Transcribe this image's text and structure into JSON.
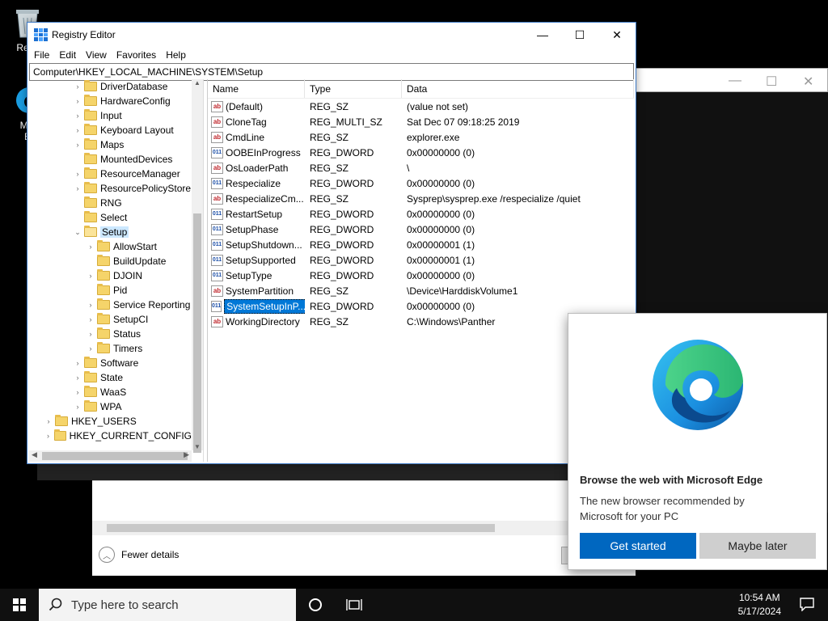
{
  "desktop": {
    "recycle_label": "Recy",
    "edge_label_1": "Mic",
    "edge_label_2": "E"
  },
  "regedit": {
    "title": "Registry Editor",
    "menu": [
      "File",
      "Edit",
      "View",
      "Favorites",
      "Help"
    ],
    "address": "Computer\\HKEY_LOCAL_MACHINE\\SYSTEM\\Setup",
    "tree": [
      {
        "label": "DriverDatabase",
        "level": 2,
        "expandable": true
      },
      {
        "label": "HardwareConfig",
        "level": 2,
        "expandable": true
      },
      {
        "label": "Input",
        "level": 2,
        "expandable": true
      },
      {
        "label": "Keyboard Layout",
        "level": 2,
        "expandable": true
      },
      {
        "label": "Maps",
        "level": 2,
        "expandable": true
      },
      {
        "label": "MountedDevices",
        "level": 2,
        "expandable": false
      },
      {
        "label": "ResourceManager",
        "level": 2,
        "expandable": true
      },
      {
        "label": "ResourcePolicyStore",
        "level": 2,
        "expandable": true
      },
      {
        "label": "RNG",
        "level": 2,
        "expandable": false
      },
      {
        "label": "Select",
        "level": 2,
        "expandable": false
      },
      {
        "label": "Setup",
        "level": 2,
        "expandable": true,
        "open": true,
        "selected": true
      },
      {
        "label": "AllowStart",
        "level": 3,
        "expandable": true
      },
      {
        "label": "BuildUpdate",
        "level": 3,
        "expandable": false
      },
      {
        "label": "DJOIN",
        "level": 3,
        "expandable": true
      },
      {
        "label": "Pid",
        "level": 3,
        "expandable": false
      },
      {
        "label": "Service Reporting",
        "level": 3,
        "expandable": true
      },
      {
        "label": "SetupCI",
        "level": 3,
        "expandable": true
      },
      {
        "label": "Status",
        "level": 3,
        "expandable": true
      },
      {
        "label": "Timers",
        "level": 3,
        "expandable": true
      },
      {
        "label": "Software",
        "level": 2,
        "expandable": true
      },
      {
        "label": "State",
        "level": 2,
        "expandable": true
      },
      {
        "label": "WaaS",
        "level": 2,
        "expandable": true
      },
      {
        "label": "WPA",
        "level": 2,
        "expandable": true
      },
      {
        "label": "HKEY_USERS",
        "level": 0,
        "expandable": true
      },
      {
        "label": "HKEY_CURRENT_CONFIG",
        "level": 0,
        "expandable": true
      }
    ],
    "columns": {
      "name": "Name",
      "type": "Type",
      "data": "Data"
    },
    "values": [
      {
        "icon": "ab",
        "name": "(Default)",
        "type": "REG_SZ",
        "data": "(value not set)"
      },
      {
        "icon": "ab",
        "name": "CloneTag",
        "type": "REG_MULTI_SZ",
        "data": "Sat Dec 07 09:18:25 2019"
      },
      {
        "icon": "ab",
        "name": "CmdLine",
        "type": "REG_SZ",
        "data": "explorer.exe"
      },
      {
        "icon": "bin",
        "name": "OOBEInProgress",
        "type": "REG_DWORD",
        "data": "0x00000000 (0)"
      },
      {
        "icon": "ab",
        "name": "OsLoaderPath",
        "type": "REG_SZ",
        "data": "\\"
      },
      {
        "icon": "bin",
        "name": "Respecialize",
        "type": "REG_DWORD",
        "data": "0x00000000 (0)"
      },
      {
        "icon": "ab",
        "name": "RespecializeCm...",
        "type": "REG_SZ",
        "data": "Sysprep\\sysprep.exe /respecialize /quiet"
      },
      {
        "icon": "bin",
        "name": "RestartSetup",
        "type": "REG_DWORD",
        "data": "0x00000000 (0)"
      },
      {
        "icon": "bin",
        "name": "SetupPhase",
        "type": "REG_DWORD",
        "data": "0x00000000 (0)"
      },
      {
        "icon": "bin",
        "name": "SetupShutdown...",
        "type": "REG_DWORD",
        "data": "0x00000001 (1)"
      },
      {
        "icon": "bin",
        "name": "SetupSupported",
        "type": "REG_DWORD",
        "data": "0x00000001 (1)"
      },
      {
        "icon": "bin",
        "name": "SetupType",
        "type": "REG_DWORD",
        "data": "0x00000000 (0)"
      },
      {
        "icon": "ab",
        "name": "SystemPartition",
        "type": "REG_SZ",
        "data": "\\Device\\HarddiskVolume1"
      },
      {
        "icon": "bin",
        "name": "SystemSetupInP...",
        "type": "REG_DWORD",
        "data": "0x00000000 (0)",
        "selected": true
      },
      {
        "icon": "ab",
        "name": "WorkingDirectory",
        "type": "REG_SZ",
        "data": "C:\\Windows\\Panther"
      }
    ]
  },
  "taskmgr": {
    "fewer_details": "Fewer details"
  },
  "edge_popup": {
    "title": "Browse the web with Microsoft Edge",
    "description": "The new browser recommended by Microsoft for your PC",
    "primary_button": "Get started",
    "secondary_button": "Maybe later"
  },
  "taskbar": {
    "search_placeholder": "Type here to search",
    "time": "10:54 AM",
    "date": "5/17/2024"
  }
}
